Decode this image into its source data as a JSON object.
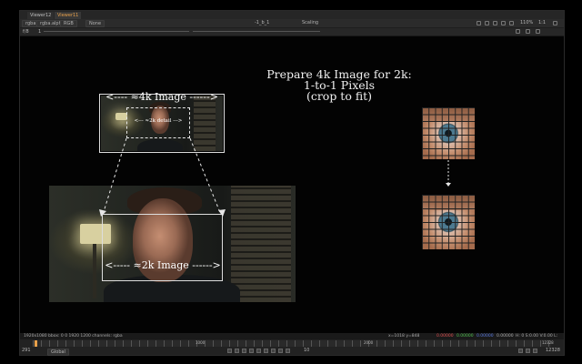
{
  "tabs": [
    "Viewer12",
    "Viewer11"
  ],
  "toolbar": {
    "channels": "rgba",
    "channel2": "rgba.alpha",
    "colorspace": "RGB",
    "none": "None",
    "input_a": "-1_b_1",
    "input_b": "Scaling",
    "zoom": "110%",
    "ratio": "1:1",
    "row2_left": "f/8",
    "row2_num": "1"
  },
  "slide": {
    "title_lines": [
      "Prepare 4k Image for 2k:",
      "1-to-1 Pixels",
      "(crop to fit)"
    ],
    "label_4k": "<---- ≈4k Image ------>",
    "label_2k_detail": "<--- ≈2k detail --->",
    "label_2k": "<----- ≈2k Image ------>"
  },
  "infobar": {
    "left": "1920x1080  bbox: 0 0 1920 1200 channels: rgba",
    "coords": "x=1018 y=848",
    "r": "0.00000",
    "g": "0.00000",
    "b": "0.00000",
    "a": "0.00000",
    "hsv": "H: 0 S:0.00 V:0.00  L: 0.00000"
  },
  "timeline": {
    "frame_left": "291",
    "mode": "Global",
    "tick_mid1": "1000",
    "tick_mid2": "2000",
    "fps_field": "10",
    "end_frame": "12328",
    "frame_right": "12328"
  }
}
